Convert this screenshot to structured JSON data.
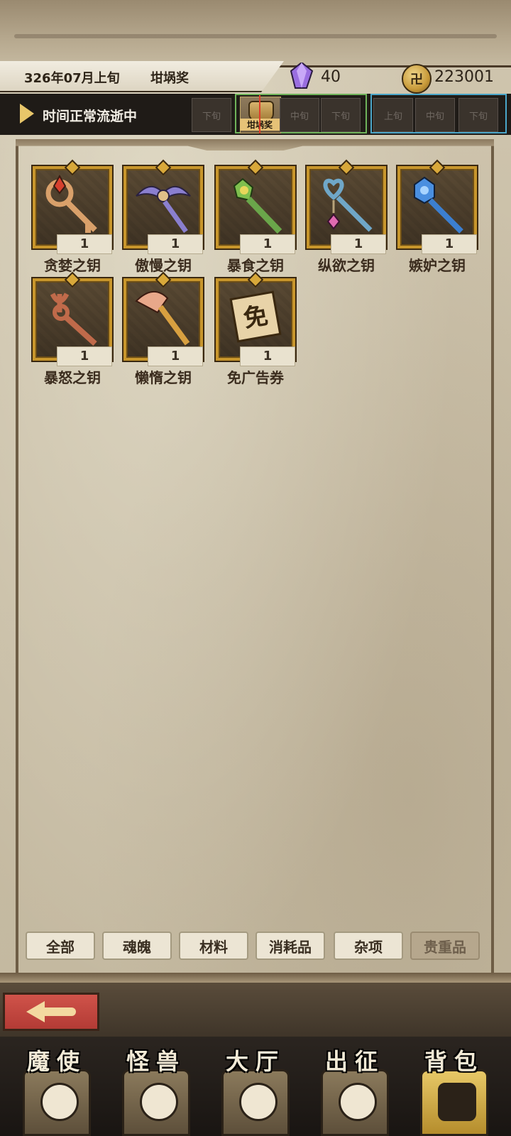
{
  "header": {
    "date": "326年07月上旬",
    "reward_label": "坩埚奖",
    "gem_count": "40",
    "coin_count": "223001",
    "coin_symbol": "卍"
  },
  "time_bar": {
    "status": "时间正常流逝中",
    "slots": [
      "下旬",
      "中旬",
      "下旬",
      "上旬",
      "中旬",
      "下旬"
    ],
    "current_label": "坩埚奖"
  },
  "items": [
    {
      "name": "贪婪之钥",
      "count": "1",
      "icon": "greed-key-icon"
    },
    {
      "name": "傲慢之钥",
      "count": "1",
      "icon": "pride-key-icon"
    },
    {
      "name": "暴食之钥",
      "count": "1",
      "icon": "gluttony-key-icon"
    },
    {
      "name": "纵欲之钥",
      "count": "1",
      "icon": "lust-key-icon"
    },
    {
      "name": "嫉妒之钥",
      "count": "1",
      "icon": "envy-key-icon"
    },
    {
      "name": "暴怒之钥",
      "count": "1",
      "icon": "wrath-key-icon"
    },
    {
      "name": "懒惰之钥",
      "count": "1",
      "icon": "sloth-key-icon"
    },
    {
      "name": "免广告券",
      "count": "1",
      "icon": "ad-free-ticket-icon",
      "glyph": "免"
    }
  ],
  "tabs": [
    "全部",
    "魂魄",
    "材料",
    "消耗品",
    "杂项",
    "贵重品"
  ],
  "active_tab": "贵重品",
  "bottom_nav": [
    "魔使",
    "怪兽",
    "大厅",
    "出征",
    "背包"
  ],
  "active_nav": "背包"
}
